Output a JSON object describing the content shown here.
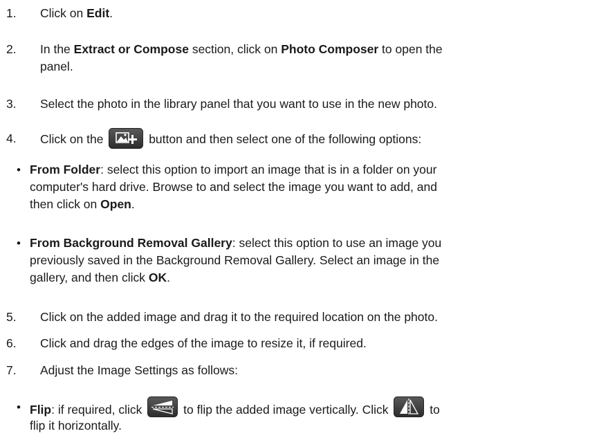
{
  "steps": [
    {
      "number": "1.",
      "before": "Click on ",
      "bold": "Edit",
      "after": "."
    },
    {
      "number": "2.",
      "t1": "In the ",
      "b1": "Extract or Compose",
      "t2": " section, click on ",
      "b2": "Photo Composer",
      "t3": " to open the",
      "line2": "panel."
    },
    {
      "number": "3.",
      "text": "Select the photo in the library panel that you want to use in the new photo."
    },
    {
      "number": "4.",
      "before": "Click on the",
      "after": "button and then select one of the following options:",
      "icon": "add-image-icon"
    },
    {
      "number": "5.",
      "text": "Click on the added image and drag it to the required location on the photo."
    },
    {
      "number": "6.",
      "text": "Click and drag the edges of the image to resize it, if required."
    },
    {
      "number": "7.",
      "text": "Adjust the Image Settings as follows:"
    }
  ],
  "bullets": [
    {
      "bullet": "•",
      "bold": "From Folder",
      "l1": ": select this option to import an image that is in a folder on your",
      "l2": "computer's hard drive. Browse to and select the image you want to add, and",
      "l3": "then click on ",
      "l3_bold": "Open",
      "l3_end": "."
    },
    {
      "bullet": "•",
      "bold": "From Background Removal Gallery",
      "l1": ": select this option to use an image you",
      "l2": "previously saved in the Background Removal Gallery. Select an image in the",
      "l3": "gallery, and then click ",
      "l3_bold": "OK",
      "l3_end": "."
    },
    {
      "bullet": "•",
      "bold": "Flip",
      "l1a": ": if required, click",
      "l1b": "to flip the added image vertically. Click",
      "l1c": "to",
      "l2": "flip it horizontally.",
      "icon_v": "flip-vertical-icon",
      "icon_h": "flip-horizontal-icon"
    }
  ],
  "colors": {
    "text": "#1a1a1a",
    "icon_bg": "#3a3a3a",
    "icon_fg": "#ffffff"
  }
}
